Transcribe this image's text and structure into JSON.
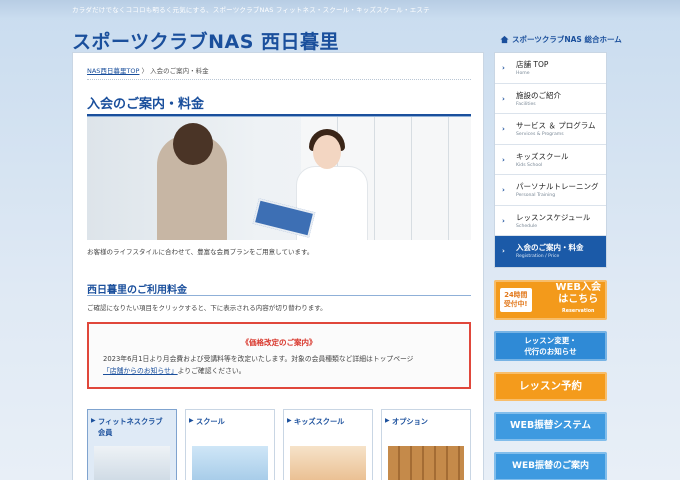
{
  "header": {
    "tagline": "カラダだけでなくココロも明るく元気にする、スポーツクラブNAS フィットネス・スクール・キッズスクール・エステ",
    "brand": "スポーツクラブNAS 西日暮里",
    "home_link": "スポーツクラブNAS 総合ホーム"
  },
  "breadcrumb": {
    "home": "NAS西日暮里TOP",
    "separator": "〉",
    "current": "入会のご案内・料金"
  },
  "page": {
    "title": "入会のご案内・料金",
    "intro": "お客様のライフスタイルに合わせて、豊富な会員プランをご用意しています。"
  },
  "fees": {
    "title": "西日暮里のご利用料金",
    "note": "ご確認になりたい項目をクリックすると、下に表示される内容が切り替わります。"
  },
  "notice": {
    "title": "《価格改定のご案内》",
    "line1": "2023年6月1日より月会費および受講料等を改定いたします。対象の会員種類など詳細はトップページ",
    "link": "「店舗からのお知らせ」",
    "line2_rest": "よりご確認ください。"
  },
  "cards": [
    {
      "label_line1": "フィットネスクラブ",
      "label_line2": "会員"
    },
    {
      "label_line1": "スクール",
      "label_line2": ""
    },
    {
      "label_line1": "キッズスクール",
      "label_line2": ""
    },
    {
      "label_line1": "オプション",
      "label_line2": ""
    }
  ],
  "nav": [
    {
      "label": "店舗 TOP",
      "sub": "Home"
    },
    {
      "label": "施設のご紹介",
      "sub": "Facilities"
    },
    {
      "label": "サービス ＆ プログラム",
      "sub": "Services & Programs"
    },
    {
      "label": "キッズスクール",
      "sub": "Kids School"
    },
    {
      "label": "パーソナルトレーニング",
      "sub": "Personal Training"
    },
    {
      "label": "レッスンスケジュール",
      "sub": "Schedule"
    },
    {
      "label": "入会のご案内・料金",
      "sub": "Registration / Price"
    }
  ],
  "banners": {
    "web_left_1": "24時間",
    "web_left_2": "受付中!",
    "web_right_1": "WEB入会",
    "web_right_2": "はこちら",
    "web_right_sub": "Reservation",
    "change_1": "レッスン変更・",
    "change_2": "代行のお知らせ",
    "lesson": "レッスン予約",
    "webswap": "WEB振替システム",
    "webswap_guide": "WEB振替のご案内"
  },
  "colors": {
    "brand_blue": "#1a4f9c",
    "nav_active": "#1b5aa8",
    "notice_red": "#e0473b",
    "orange": "#f39a1b",
    "light_blue": "#3e9ae0"
  }
}
